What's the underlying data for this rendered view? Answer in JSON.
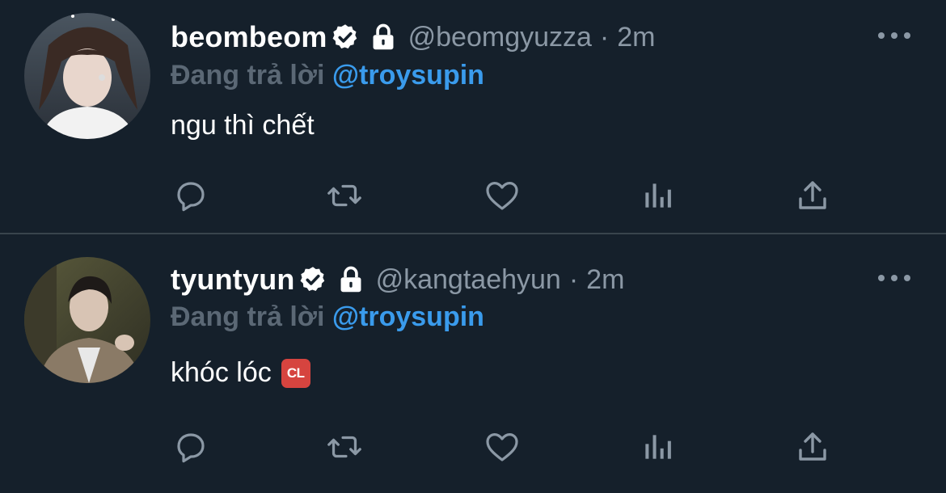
{
  "tweets": [
    {
      "display_name": "beombeom",
      "handle": "@beomgyuzza",
      "separator": "·",
      "time": "2m",
      "reply_prefix": "Đang trả lời",
      "reply_mention": "@troysupin",
      "text": "ngu thì chết",
      "emoji": "",
      "verified": true,
      "locked": true
    },
    {
      "display_name": "tyuntyun",
      "handle": "@kangtaehyun",
      "separator": "·",
      "time": "2m",
      "reply_prefix": "Đang trả lời",
      "reply_mention": "@troysupin",
      "text": "khóc lóc",
      "emoji": "CL",
      "verified": true,
      "locked": true
    }
  ],
  "icons": {
    "reply": "reply-icon",
    "retweet": "retweet-icon",
    "like": "heart-icon",
    "views": "views-icon",
    "share": "share-icon",
    "more": "more-icon"
  },
  "colors": {
    "background": "#15202b",
    "divider": "#38444d",
    "secondary_text": "#8b98a5",
    "mention": "#3a9bec",
    "emoji_red": "#d6443f"
  }
}
